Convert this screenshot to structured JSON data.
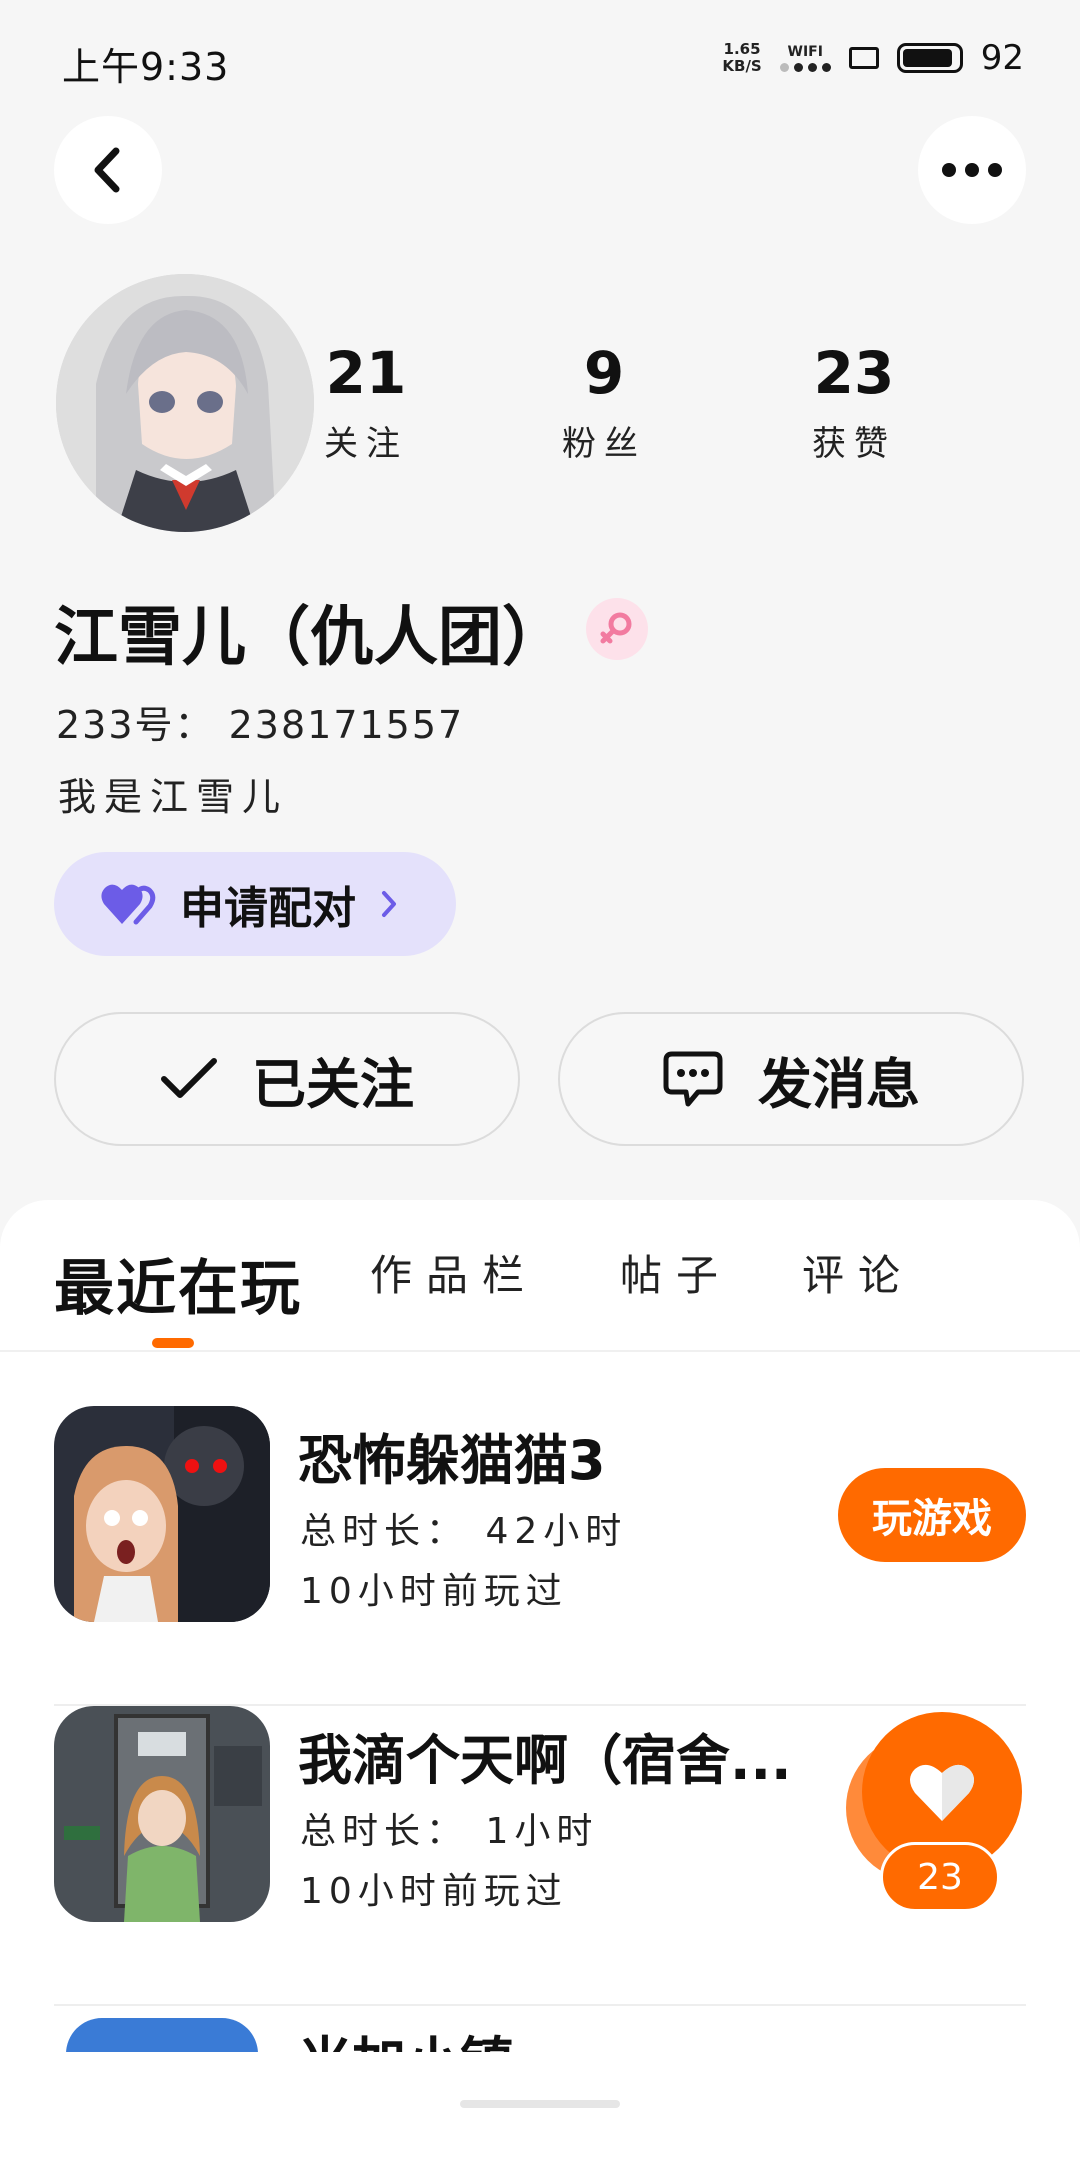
{
  "status_bar": {
    "time": "上午9:33",
    "net_speed_value": "1.65",
    "net_speed_unit": "KB/S",
    "wifi_label": "WIFI",
    "battery_level": "92"
  },
  "header": {
    "back_icon": "chevron-left-icon",
    "more_icon": "more-horizontal-icon"
  },
  "profile": {
    "name": "江雪儿（仇人团）",
    "gender_icon": "female-icon",
    "gender_color": "#f27ba0",
    "account_id": "233号： 238171557",
    "bio": "我是江雪儿",
    "stats": [
      {
        "value": "21",
        "label": "关注"
      },
      {
        "value": "9",
        "label": "粉丝"
      },
      {
        "value": "23",
        "label": "获赞"
      }
    ],
    "pair_button": {
      "label": "申请配对",
      "icon": "heart-icon",
      "color": "#6c5ce7"
    },
    "follow_button": {
      "label": "已关注",
      "icon": "check-icon"
    },
    "message_button": {
      "label": "发消息",
      "icon": "chat-bubble-icon"
    }
  },
  "tabs": [
    {
      "label": "最近在玩",
      "active": true
    },
    {
      "label": "作品栏",
      "active": false
    },
    {
      "label": "帖子",
      "active": false
    },
    {
      "label": "评论",
      "active": false
    }
  ],
  "games": [
    {
      "title": "恐怖躲猫猫3",
      "duration": "总时长： 42小时",
      "last_played": "10小时前玩过",
      "action": "玩游戏"
    },
    {
      "title": "我滴个天啊（宿舍...",
      "duration": "总时长： 1小时",
      "last_played": "10小时前玩过"
    },
    {
      "title": "米加小镇"
    }
  ],
  "like_fab": {
    "count": "23"
  },
  "colors": {
    "accent": "#ff6a00",
    "pair_bg": "#e4e1fb",
    "background": "#f6f6f6"
  }
}
